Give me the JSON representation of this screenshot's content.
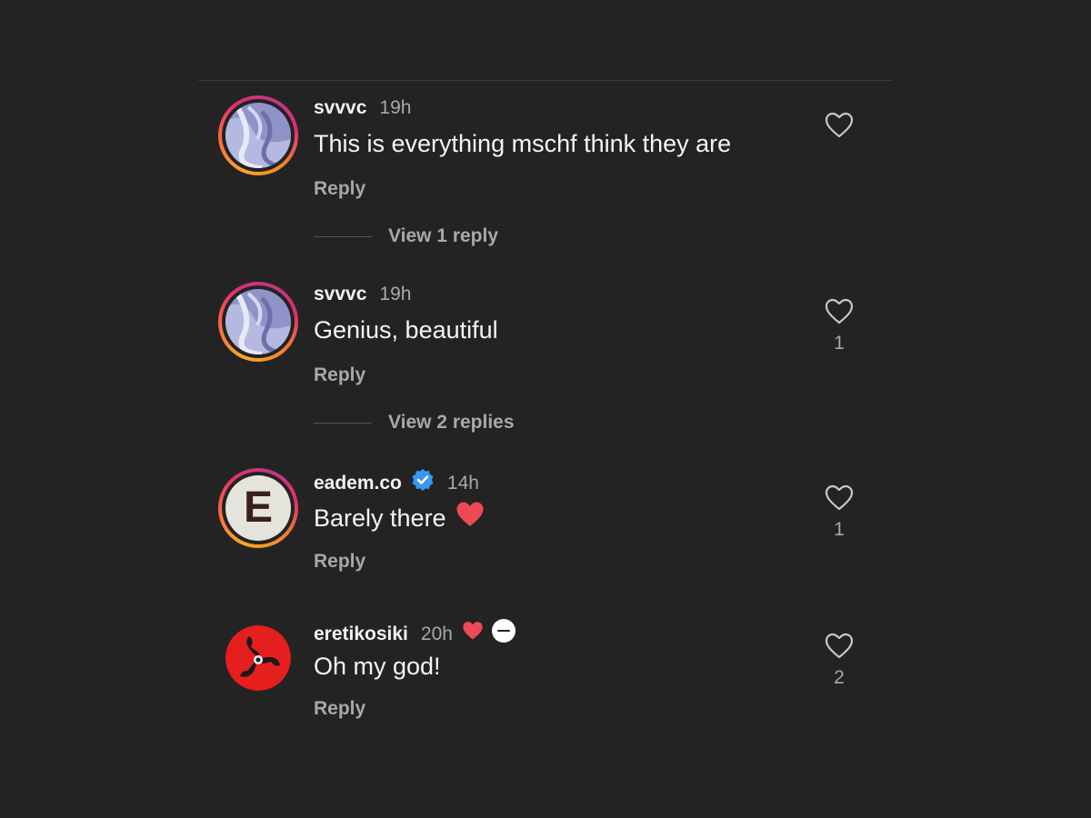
{
  "comments": [
    {
      "username": "svvvc",
      "time": "19h",
      "text": "This is everything mschf think they are",
      "reply_label": "Reply",
      "like_count": "",
      "view_replies": "View 1 reply"
    },
    {
      "username": "svvvc",
      "time": "19h",
      "text": "Genius, beautiful",
      "reply_label": "Reply",
      "like_count": "1",
      "view_replies": "View 2 replies"
    },
    {
      "username": "eadem.co",
      "time": "14h",
      "text": "Barely there",
      "avatar_letter": "E",
      "reply_label": "Reply",
      "like_count": "1"
    },
    {
      "username": "eretikosiki",
      "time": "20h",
      "text": "Oh my god!",
      "reply_label": "Reply",
      "like_count": "2"
    }
  ],
  "colors": {
    "background": "#232323",
    "muted_text": "#a8a8a8",
    "verified_blue": "#3897f0",
    "heart_red": "#ed4956"
  },
  "icons": [
    "heart-outline-icon",
    "verified-badge-icon",
    "red-heart-icon",
    "creator-badge-icon"
  ]
}
